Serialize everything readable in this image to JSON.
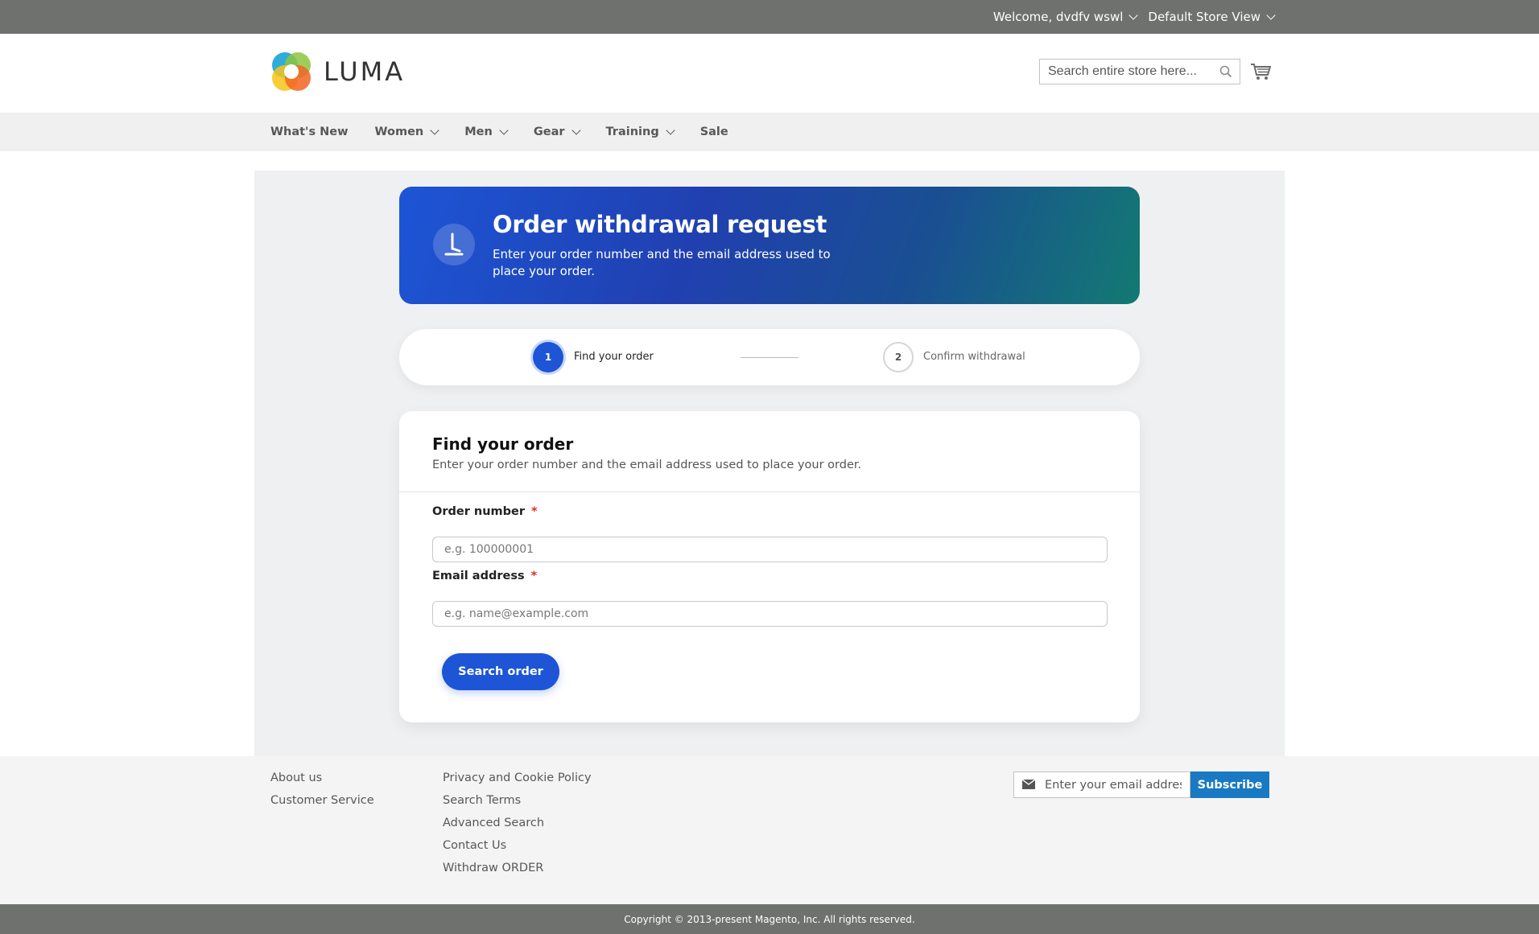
{
  "topbar": {
    "welcome": "Welcome, dvdfv wswl",
    "store_view": "Default Store View"
  },
  "header": {
    "logo_text": "LUMA",
    "search_placeholder": "Search entire store here..."
  },
  "nav": {
    "items": [
      {
        "label": "What's New",
        "dropdown": false
      },
      {
        "label": "Women",
        "dropdown": true
      },
      {
        "label": "Men",
        "dropdown": true
      },
      {
        "label": "Gear",
        "dropdown": true
      },
      {
        "label": "Training",
        "dropdown": true
      },
      {
        "label": "Sale",
        "dropdown": false
      }
    ]
  },
  "hero": {
    "icon": "withdraw-icon",
    "title": "Order withdrawal request",
    "subtitle": "Enter your order number and the email address used to place your order."
  },
  "steps": [
    {
      "number": "1",
      "label": "Find your order",
      "active": true
    },
    {
      "number": "2",
      "label": "Confirm withdrawal",
      "active": false
    }
  ],
  "form": {
    "title": "Find your order",
    "subtitle": "Enter your order number and the email address used to place your order.",
    "order_label": "Order number",
    "order_placeholder": "e.g. 100000001",
    "email_label": "Email address",
    "email_placeholder": "e.g. name@example.com",
    "required_mark": "*",
    "submit_label": "Search order"
  },
  "footer": {
    "col1": [
      "About us",
      "Customer Service"
    ],
    "col2": [
      "Privacy and Cookie Policy",
      "Search Terms",
      "Advanced Search",
      "Contact Us",
      "Withdraw ORDER"
    ],
    "newsletter_placeholder": "Enter your email address",
    "subscribe_label": "Subscribe"
  },
  "copyright": "Copyright © 2013-present Magento, Inc. All rights reserved.",
  "colors": {
    "accent": "#1d55d6",
    "topbar": "#6e716e",
    "subscribe": "#1979c3"
  }
}
